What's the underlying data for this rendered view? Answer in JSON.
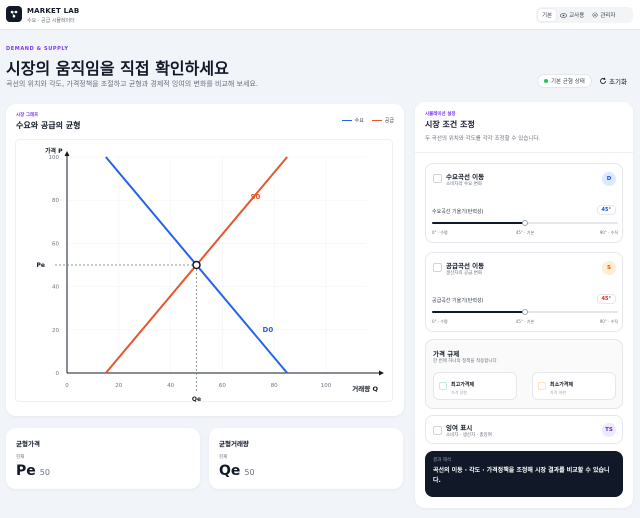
{
  "header": {
    "brand_title": "MARKET LAB",
    "brand_sub": "수요 · 공급 시뮬레이터",
    "modes": [
      {
        "label": "기본",
        "icon": "none",
        "active": true
      },
      {
        "label": "교사용",
        "icon": "eye-icon",
        "active": false
      },
      {
        "label": "관리자",
        "icon": "gear-icon",
        "active": false
      }
    ]
  },
  "hero": {
    "eyebrow": "DEMAND & SUPPLY",
    "title": "시장의 움직임을 직접 확인하세요",
    "description": "곡선의 위치와 각도, 가격정책을 조절하고 균형과 경제적 잉여의 변화를 비교해 보세요.",
    "status_label": "기본 균형 상태",
    "reset_label": "초기화"
  },
  "graph": {
    "small_label": "시장 그래프",
    "title": "수요와 공급의 균형",
    "legend": [
      {
        "label": "수요",
        "color": "#2563eb"
      },
      {
        "label": "공급",
        "color": "#e4572e"
      }
    ]
  },
  "chart_data": {
    "type": "line",
    "xlabel": "거래량 Q",
    "ylabel": "가격 P",
    "xlim": [
      0,
      100
    ],
    "ylim": [
      0,
      100
    ],
    "xticks": [
      "0",
      "20",
      "40",
      "60",
      "80",
      "100"
    ],
    "yticks": [
      "0",
      "20",
      "40",
      "60",
      "80",
      "100"
    ],
    "series": [
      {
        "name": "D0",
        "color": "#2563eb",
        "points": [
          [
            15,
            100
          ],
          [
            85,
            0
          ]
        ]
      },
      {
        "name": "S0",
        "color": "#e4572e",
        "points": [
          [
            15,
            0
          ],
          [
            85,
            100
          ]
        ]
      }
    ],
    "equilibrium": {
      "x": 50,
      "y": 50,
      "x_label": "Qe",
      "y_label": "Pe"
    }
  },
  "summary": {
    "price": {
      "title": "균형가격",
      "sub": "현재",
      "symbol": "Pe",
      "value": "50"
    },
    "quantity": {
      "title": "균형거래량",
      "sub": "현재",
      "symbol": "Qe",
      "value": "50"
    }
  },
  "panel": {
    "small_label": "시뮬레이션 설정",
    "title": "시장 조건 조정",
    "description": "두 곡선의 위치와 각도를 각각 조정할 수 있습니다.",
    "demand": {
      "title": "수요곡선 이동",
      "sub": "소비자의 수요 변화",
      "badge": "D",
      "slider_label": "수요곡선 기울기(탄력성)",
      "value": "45°",
      "fraction": 0.5,
      "ticks": [
        "0° · 수평",
        "45° · 기본",
        "90° · 수직"
      ]
    },
    "supply": {
      "title": "공급곡선 이동",
      "sub": "생산자의 공급 변화",
      "badge": "S",
      "slider_label": "공급곡선 기울기(탄력성)",
      "value": "45°",
      "fraction": 0.5,
      "ticks": [
        "0° · 수평",
        "45° · 기본",
        "90° · 수직"
      ]
    },
    "price_control": {
      "title": "가격 규제",
      "sub": "한 번에 하나의 정책을 적용합니다.",
      "options": [
        {
          "title": "최고가격제",
          "sub": "가격 상한"
        },
        {
          "title": "최소가격제",
          "sub": "가격 하한"
        }
      ]
    },
    "surplus": {
      "title": "잉여 표시",
      "sub": "소비자 · 생산자 · 총잉여",
      "badge": "TS"
    },
    "result": {
      "label": "결과 해석",
      "text": "곡선의 이동 · 각도 · 가격정책을 조정해 시장 결과를 비교할 수 있습니다."
    }
  }
}
